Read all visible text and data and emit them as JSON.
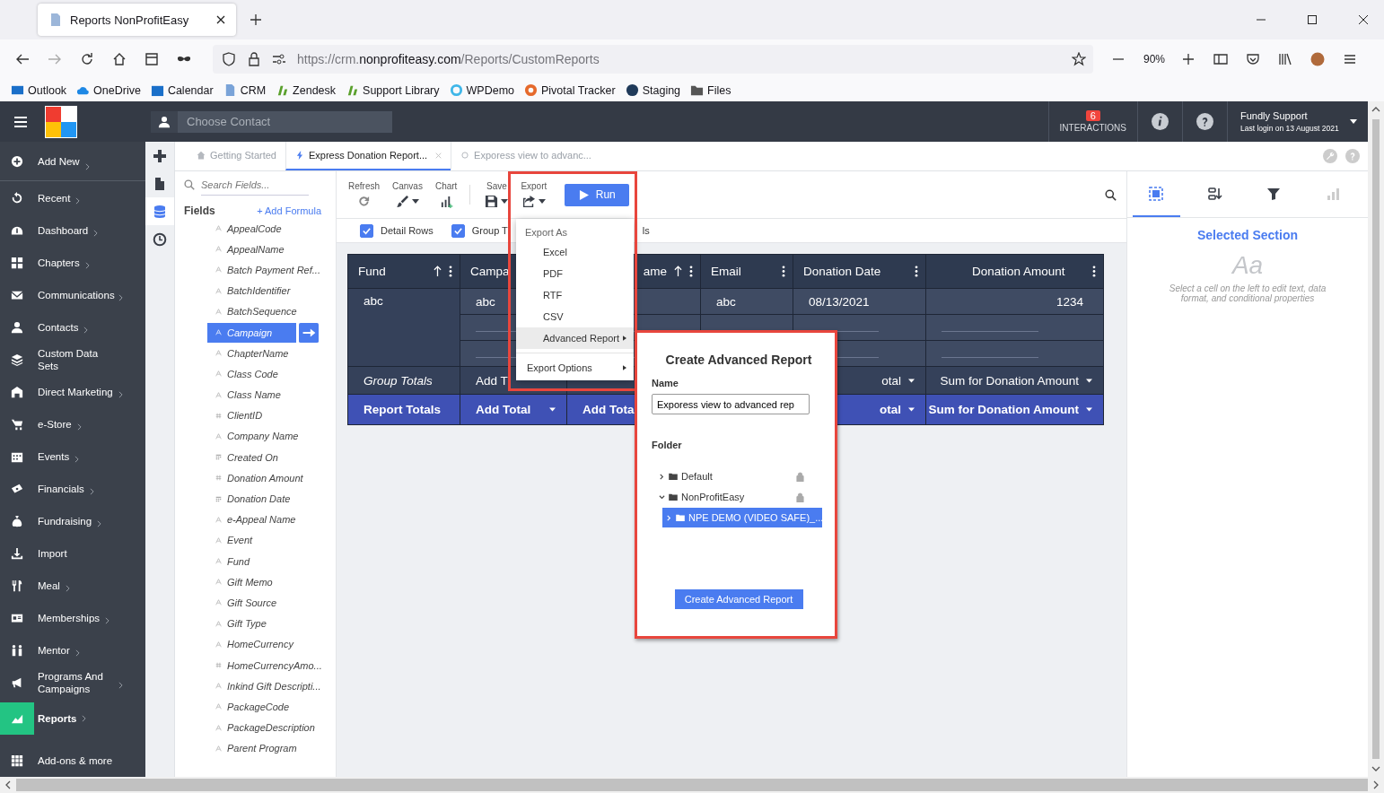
{
  "browser": {
    "tab": {
      "title": "Reports NonProfitEasy"
    },
    "url": {
      "scheme": "https://crm.",
      "domain": "nonprofiteasy.com",
      "path": "/Reports/CustomReports"
    },
    "zoom": "90%",
    "bookmarks": [
      "Outlook",
      "OneDrive",
      "Calendar",
      "CRM",
      "Zendesk",
      "Support Library",
      "WPDemo",
      "Pivotal Tracker",
      "Staging",
      "Files"
    ]
  },
  "header": {
    "contact_placeholder": "Choose Contact",
    "interactions": {
      "count": "6",
      "label": "INTERACTIONS"
    },
    "user": {
      "name": "Fundly Support",
      "last_login": "Last login on 13 August 2021"
    }
  },
  "sidebar": {
    "items": [
      {
        "label": "Add New",
        "submenu": true,
        "selected": false
      },
      {
        "label": "Recent",
        "submenu": true,
        "selected": false
      },
      {
        "label": "Dashboard",
        "submenu": true,
        "selected": false
      },
      {
        "label": "Chapters",
        "submenu": true,
        "selected": false
      },
      {
        "label": "Communications",
        "submenu": true,
        "selected": false
      },
      {
        "label": "Contacts",
        "submenu": true,
        "selected": false
      },
      {
        "label": "Custom Data Sets",
        "submenu": false,
        "selected": false
      },
      {
        "label": "Direct Marketing",
        "submenu": true,
        "selected": false
      },
      {
        "label": "e-Store",
        "submenu": true,
        "selected": false
      },
      {
        "label": "Events",
        "submenu": true,
        "selected": false
      },
      {
        "label": "Financials",
        "submenu": true,
        "selected": false
      },
      {
        "label": "Fundraising",
        "submenu": true,
        "selected": false
      },
      {
        "label": "Import",
        "submenu": false,
        "selected": false
      },
      {
        "label": "Meal",
        "submenu": true,
        "selected": false
      },
      {
        "label": "Memberships",
        "submenu": true,
        "selected": false
      },
      {
        "label": "Mentor",
        "submenu": true,
        "selected": false
      },
      {
        "label": "Programs And Campaigns",
        "submenu": true,
        "selected": false
      },
      {
        "label": "Reports",
        "submenu": true,
        "selected": true
      },
      {
        "label": "Add-ons & more",
        "submenu": false,
        "selected": false
      }
    ]
  },
  "tool_rail": [
    {
      "selected": false
    },
    {
      "selected": false
    },
    {
      "selected": true
    },
    {
      "selected": false
    }
  ],
  "tabs": [
    {
      "label": "Getting Started",
      "kind": "home",
      "selected": false,
      "closable": false
    },
    {
      "label": "Express Donation Report...",
      "kind": "bolt",
      "selected": true,
      "closable": true
    },
    {
      "label": "Exporess view to advanc...",
      "kind": "draft",
      "selected": false,
      "closable": false
    }
  ],
  "fields_panel": {
    "search_placeholder": "Search Fields...",
    "title": "Fields",
    "add_formula": "+ Add Formula",
    "fields": [
      {
        "name": "AppealCode",
        "kind": "text",
        "selected": false
      },
      {
        "name": "AppealName",
        "kind": "text",
        "selected": false
      },
      {
        "name": "Batch Payment Ref...",
        "kind": "text",
        "selected": false
      },
      {
        "name": "BatchIdentifier",
        "kind": "text",
        "selected": false
      },
      {
        "name": "BatchSequence",
        "kind": "text",
        "selected": false
      },
      {
        "name": "Campaign",
        "kind": "text",
        "selected": true
      },
      {
        "name": "ChapterName",
        "kind": "text",
        "selected": false
      },
      {
        "name": "Class Code",
        "kind": "text",
        "selected": false
      },
      {
        "name": "Class Name",
        "kind": "text",
        "selected": false
      },
      {
        "name": "ClientID",
        "kind": "number",
        "selected": false
      },
      {
        "name": "Company Name",
        "kind": "text",
        "selected": false
      },
      {
        "name": "Created On",
        "kind": "date",
        "selected": false
      },
      {
        "name": "Donation Amount",
        "kind": "number",
        "selected": false
      },
      {
        "name": "Donation Date",
        "kind": "date",
        "selected": false
      },
      {
        "name": "e-Appeal Name",
        "kind": "text",
        "selected": false
      },
      {
        "name": "Event",
        "kind": "text",
        "selected": false
      },
      {
        "name": "Fund",
        "kind": "text",
        "selected": false
      },
      {
        "name": "Gift Memo",
        "kind": "text",
        "selected": false
      },
      {
        "name": "Gift Source",
        "kind": "text",
        "selected": false
      },
      {
        "name": "Gift Type",
        "kind": "text",
        "selected": false
      },
      {
        "name": "HomeCurrency",
        "kind": "text",
        "selected": false
      },
      {
        "name": "HomeCurrencyAmo...",
        "kind": "number",
        "selected": false
      },
      {
        "name": "Inkind Gift Descripti...",
        "kind": "text",
        "selected": false
      },
      {
        "name": "PackageCode",
        "kind": "text",
        "selected": false
      },
      {
        "name": "PackageDescription",
        "kind": "text",
        "selected": false
      },
      {
        "name": "Parent Program",
        "kind": "text",
        "selected": false
      }
    ]
  },
  "toolbar": {
    "buttons": [
      {
        "label": "Refresh",
        "kind": "refresh"
      },
      {
        "label": "Canvas",
        "kind": "canvas"
      },
      {
        "label": "Chart",
        "kind": "chart"
      },
      {
        "label": "Save",
        "kind": "save"
      },
      {
        "label": "Export",
        "kind": "export"
      }
    ],
    "run": "Run"
  },
  "options": {
    "items": [
      {
        "label": "Detail Rows",
        "checked": true
      },
      {
        "label": "Group T",
        "checked": true
      }
    ],
    "tail": "ls"
  },
  "report_table": {
    "columns": [
      {
        "header": "Fund",
        "sort": true,
        "menu": true,
        "cell": "abc",
        "group_total": {
          "text": "Group Totals"
        },
        "report_total": {
          "text": "Report Totals"
        }
      },
      {
        "header": "Campa",
        "sort": false,
        "menu": false,
        "cell": "abc",
        "group_total": {
          "text": "Add T"
        },
        "report_total": {
          "text": "Add Total",
          "caret": true
        }
      },
      {
        "header": "ame",
        "sort": true,
        "menu": true,
        "report_total": {
          "text": "Add Tota"
        }
      },
      {
        "header": "Email",
        "sort": false,
        "menu": true,
        "cell": "abc"
      },
      {
        "header": "Donation Date",
        "sort": false,
        "menu": true,
        "cell": "08/13/2021",
        "group_total": {
          "text": "otal",
          "caret": true
        },
        "report_total": {
          "text": "otal",
          "caret": true
        }
      },
      {
        "header": "Donation Amount",
        "sort": false,
        "menu": true,
        "cell": "1234",
        "group_total": {
          "text": "Sum for Donation Amount",
          "caret": true
        },
        "report_total": {
          "text": "Sum for Donation Amount",
          "caret": true
        }
      }
    ]
  },
  "export_menu": {
    "title": "Export As",
    "items": [
      {
        "label": "Excel",
        "highlighted": false,
        "submenu": false
      },
      {
        "label": "PDF",
        "highlighted": false,
        "submenu": false
      },
      {
        "label": "RTF",
        "highlighted": false,
        "submenu": false
      },
      {
        "label": "CSV",
        "highlighted": false,
        "submenu": false
      },
      {
        "label": "Advanced Report",
        "highlighted": true,
        "submenu": true
      }
    ],
    "options": "Export Options"
  },
  "advanced_dialog": {
    "title": "Create Advanced Report",
    "name_label": "Name",
    "name_value": "Exporess view to advanced rep",
    "folder_label": "Folder",
    "folders": [
      {
        "name": "Default",
        "expanded": false,
        "locked": true,
        "selected": false
      },
      {
        "name": "NonProfitEasy",
        "expanded": true,
        "locked": true,
        "selected": false,
        "children": [
          {
            "name": "NPE DEMO (VIDEO SAFE)_...",
            "expanded": false,
            "selected": true
          }
        ]
      }
    ],
    "button": "Create Advanced Report"
  },
  "right_panel": {
    "tabs": [
      {
        "selected": true,
        "disabled": false
      },
      {
        "selected": false,
        "disabled": false
      },
      {
        "selected": false,
        "disabled": false
      },
      {
        "selected": false,
        "disabled": true
      }
    ],
    "title": "Selected Section",
    "sample": "Aa",
    "hint": "Select a cell on the left to edit text, data format, and conditional properties"
  }
}
